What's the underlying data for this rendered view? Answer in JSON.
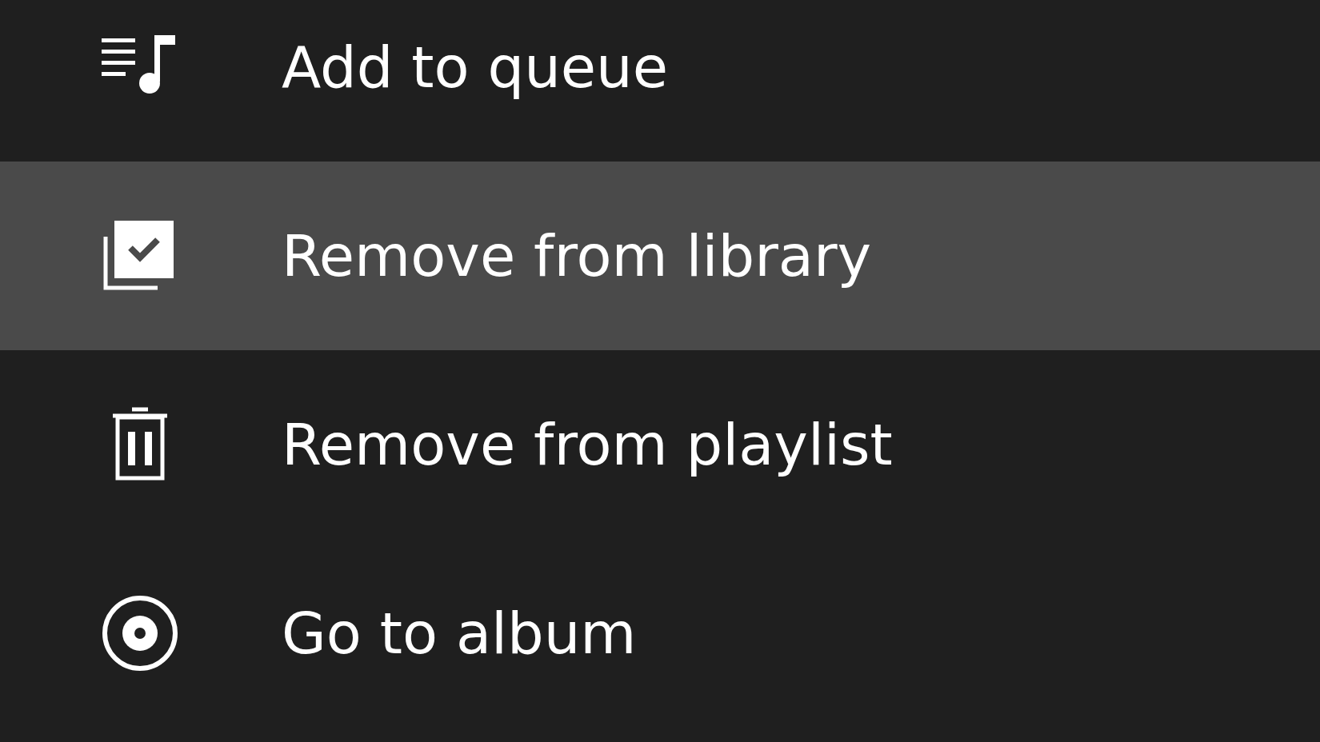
{
  "menu": {
    "items": [
      {
        "kind": "queue",
        "label": "Add to queue",
        "selected": false
      },
      {
        "kind": "library",
        "label": "Remove from library",
        "selected": true
      },
      {
        "kind": "delete",
        "label": "Remove from playlist",
        "selected": false
      },
      {
        "kind": "album",
        "label": "Go to album",
        "selected": false
      }
    ]
  }
}
